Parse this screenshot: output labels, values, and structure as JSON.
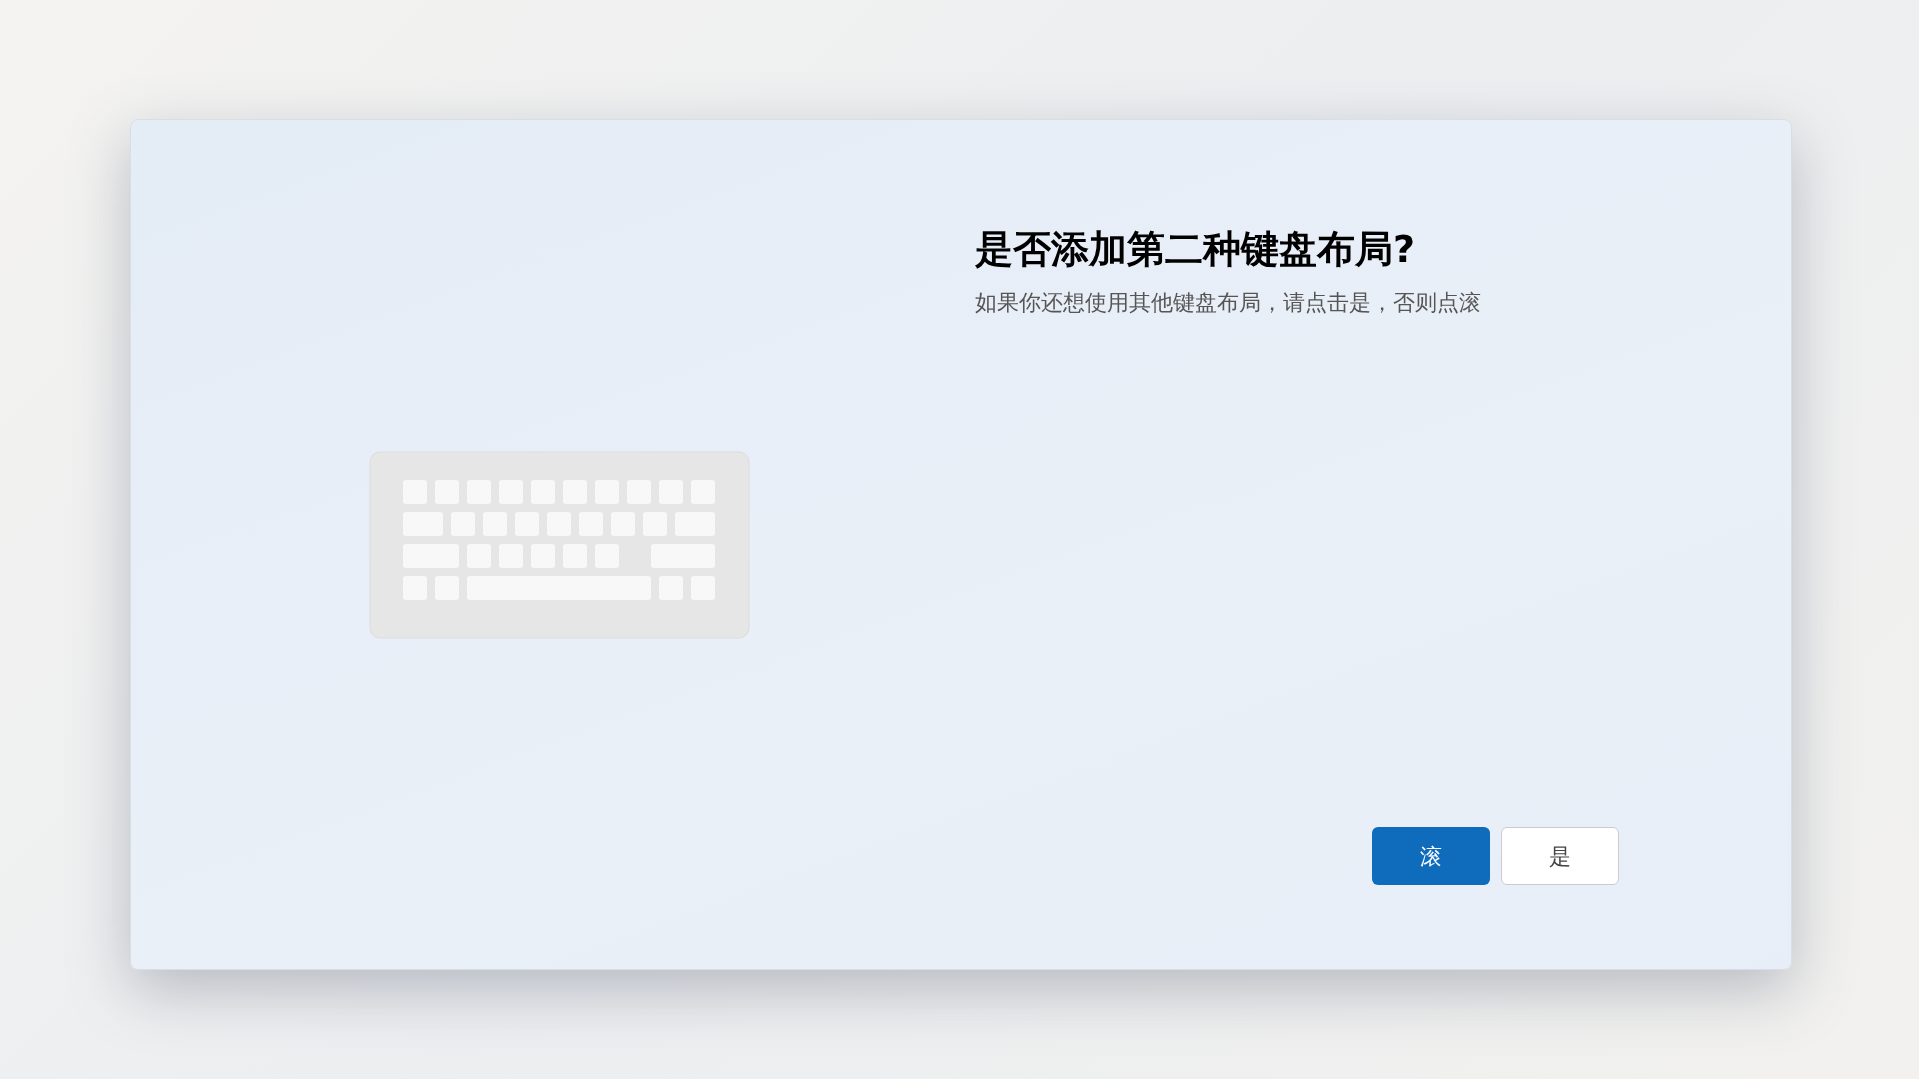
{
  "dialog": {
    "title": "是否添加第二种键盘布局?",
    "subtitle": "如果你还想使用其他键盘布局，请点击是，否则点滚"
  },
  "buttons": [
    {
      "label": "滚",
      "kind": "primary"
    },
    {
      "label": "是",
      "kind": "secondary"
    }
  ]
}
